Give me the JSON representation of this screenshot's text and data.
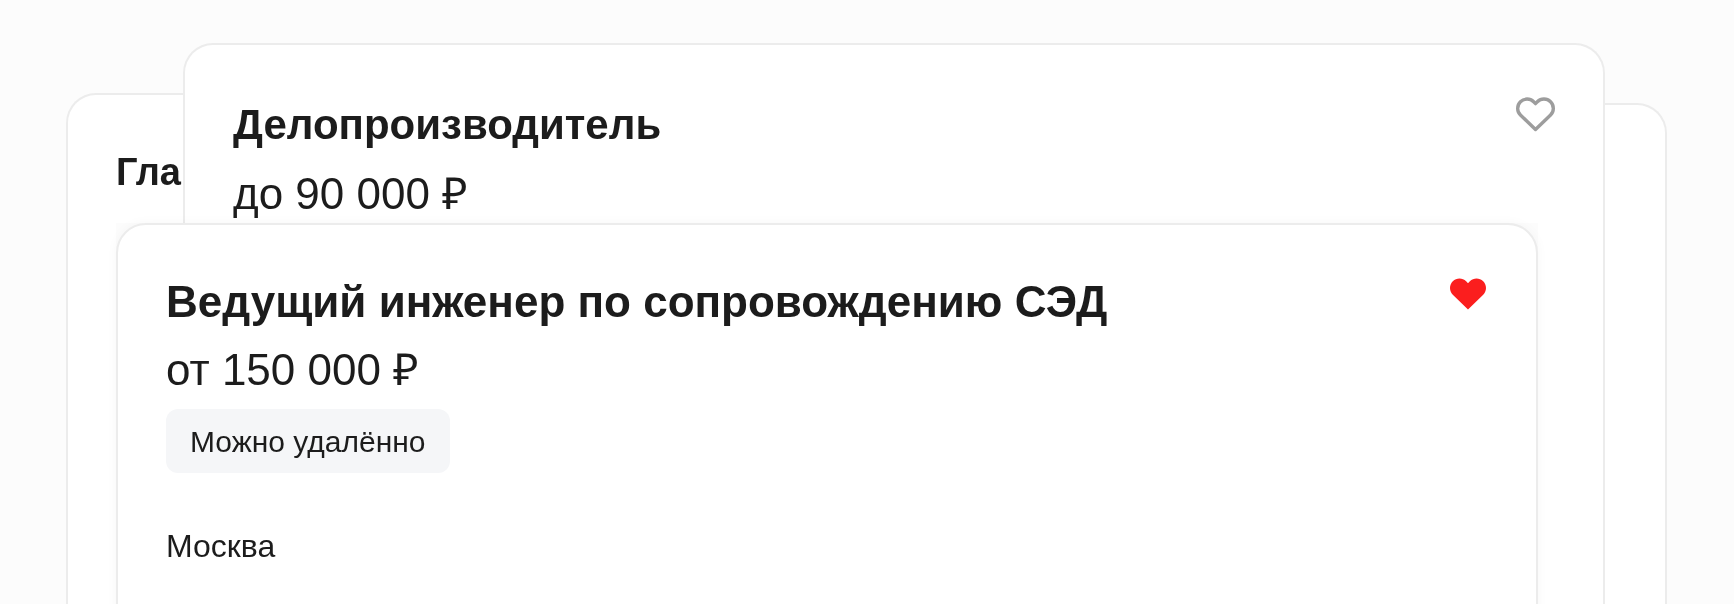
{
  "cards": [
    {
      "title": "Гла"
    },
    {
      "title": "Делопроизводитель",
      "salary": "до 90 000 ₽",
      "favorite": false
    },
    {
      "title": "Ведущий инженер по сопровождению СЭД",
      "salary": "от 150 000 ₽",
      "tags": [
        "Можно удалённо"
      ],
      "location": "Москва",
      "favorite": true
    }
  ]
}
